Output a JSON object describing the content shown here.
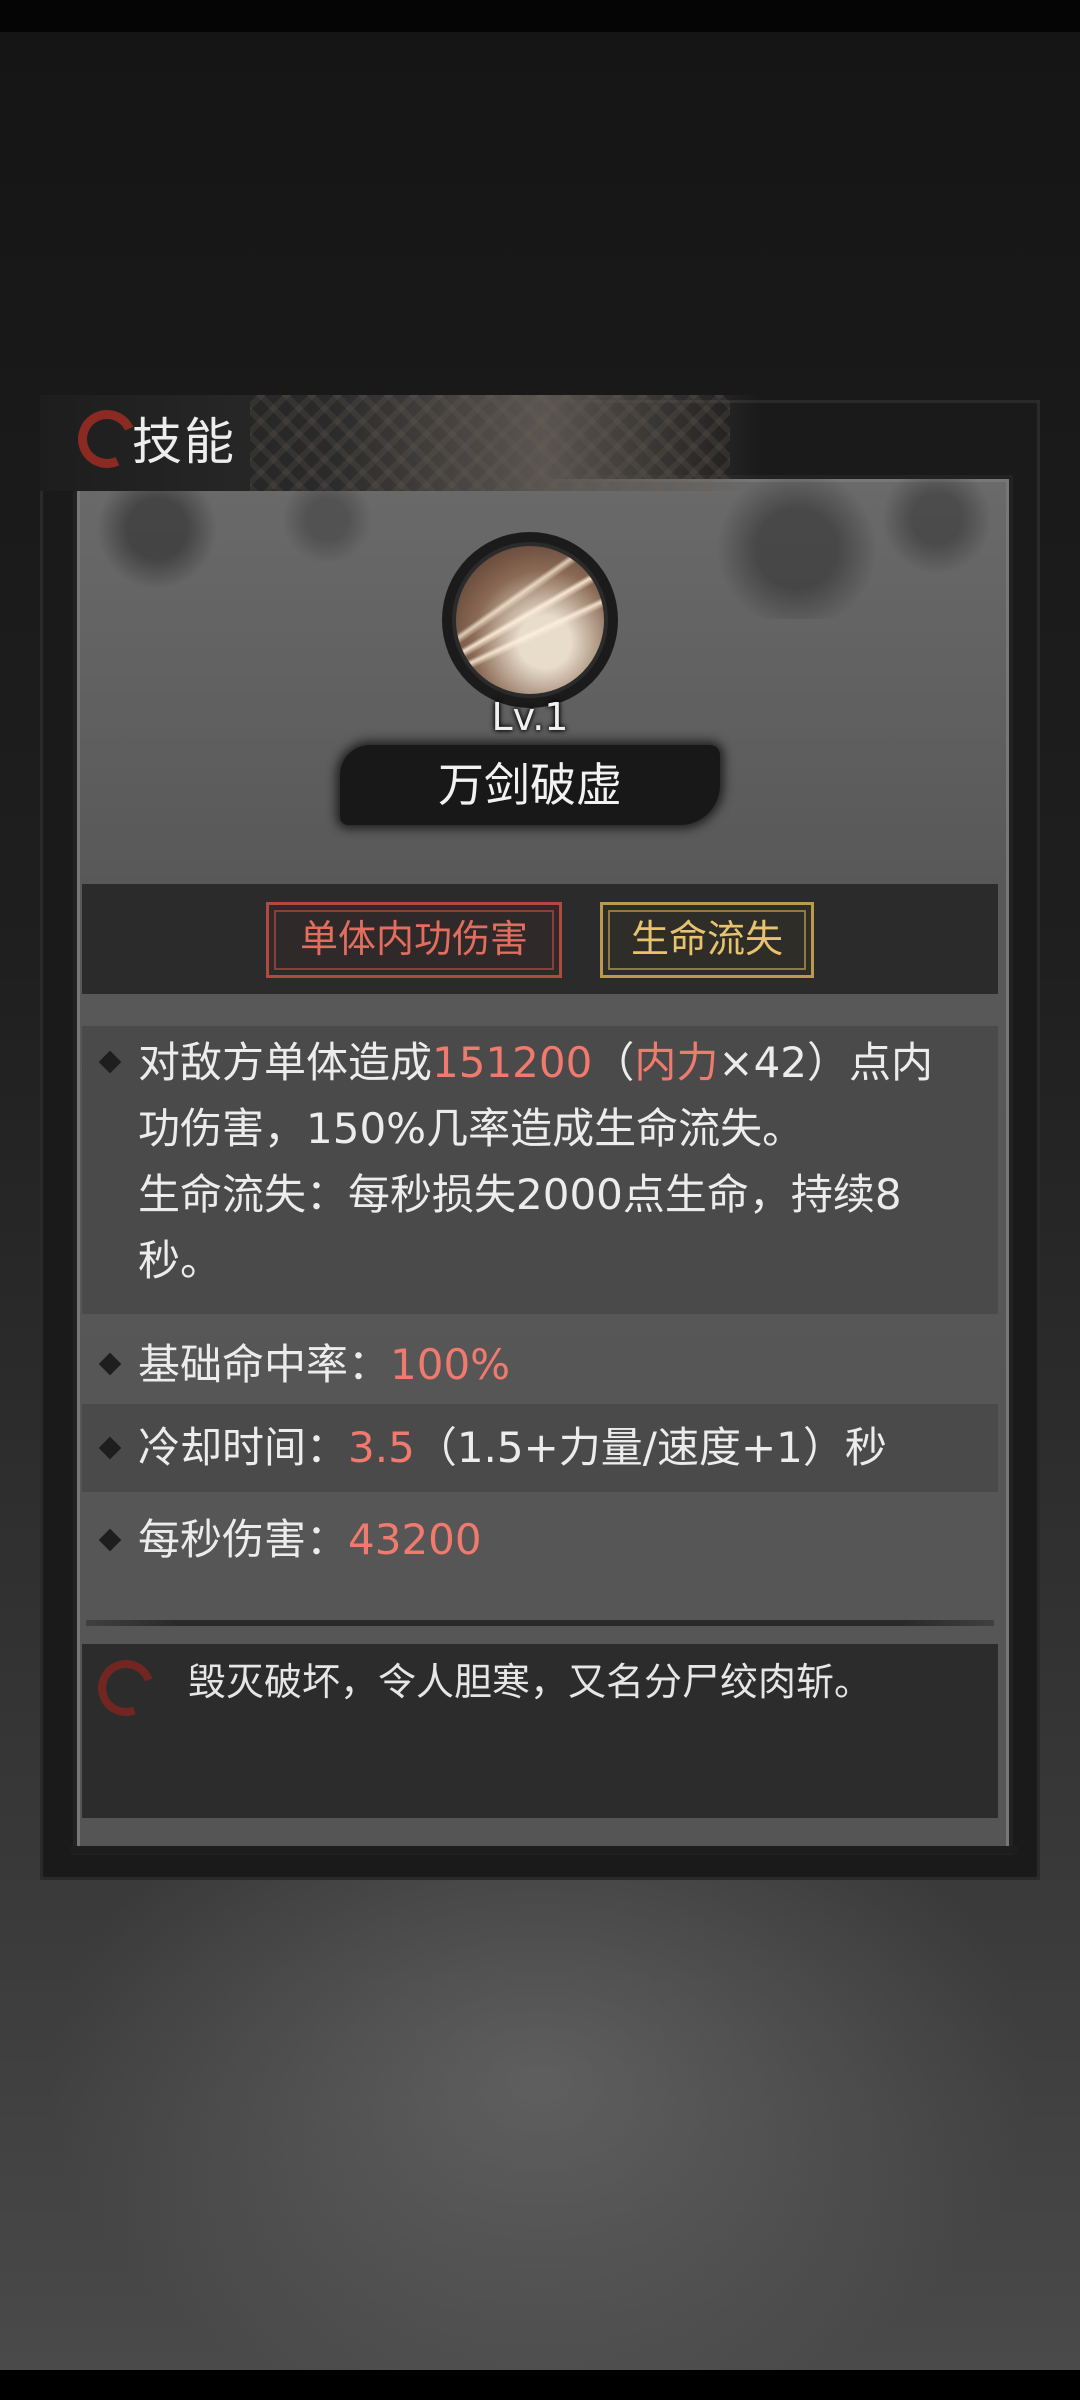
{
  "header": {
    "title": "技能"
  },
  "skill": {
    "icon": "sword-slash-orb-icon",
    "level": "Lv.1",
    "name": "万剑破虚"
  },
  "tags": [
    {
      "label": "单体内功伤害",
      "color": "#e36d5e"
    },
    {
      "label": "生命流失",
      "color": "#e8c36d"
    }
  ],
  "description": {
    "line1_a": "对敌方单体造成",
    "line1_value": "151200",
    "line1_b": "（",
    "line1_stat": "内力",
    "line1_c": "×42）点内",
    "line2": "功伤害，150%几率造成生命流失。",
    "line3": "生命流失：每秒损失2000点生命，持续8",
    "line4": "秒。"
  },
  "hit_rate": {
    "label": "基础命中率：",
    "value": "100%"
  },
  "cooldown": {
    "label": "冷却时间：",
    "value": "3.5",
    "formula": "（1.5+力量/速度+1）秒"
  },
  "dps": {
    "label": "每秒伤害：",
    "value": "43200"
  },
  "flavor": {
    "text": "毁灭破坏，令人胆寒，又名分尸绞肉斩。"
  },
  "colors": {
    "highlight": "#f07a6e",
    "panel": "#595959",
    "accent_red": "#8a2a22"
  }
}
